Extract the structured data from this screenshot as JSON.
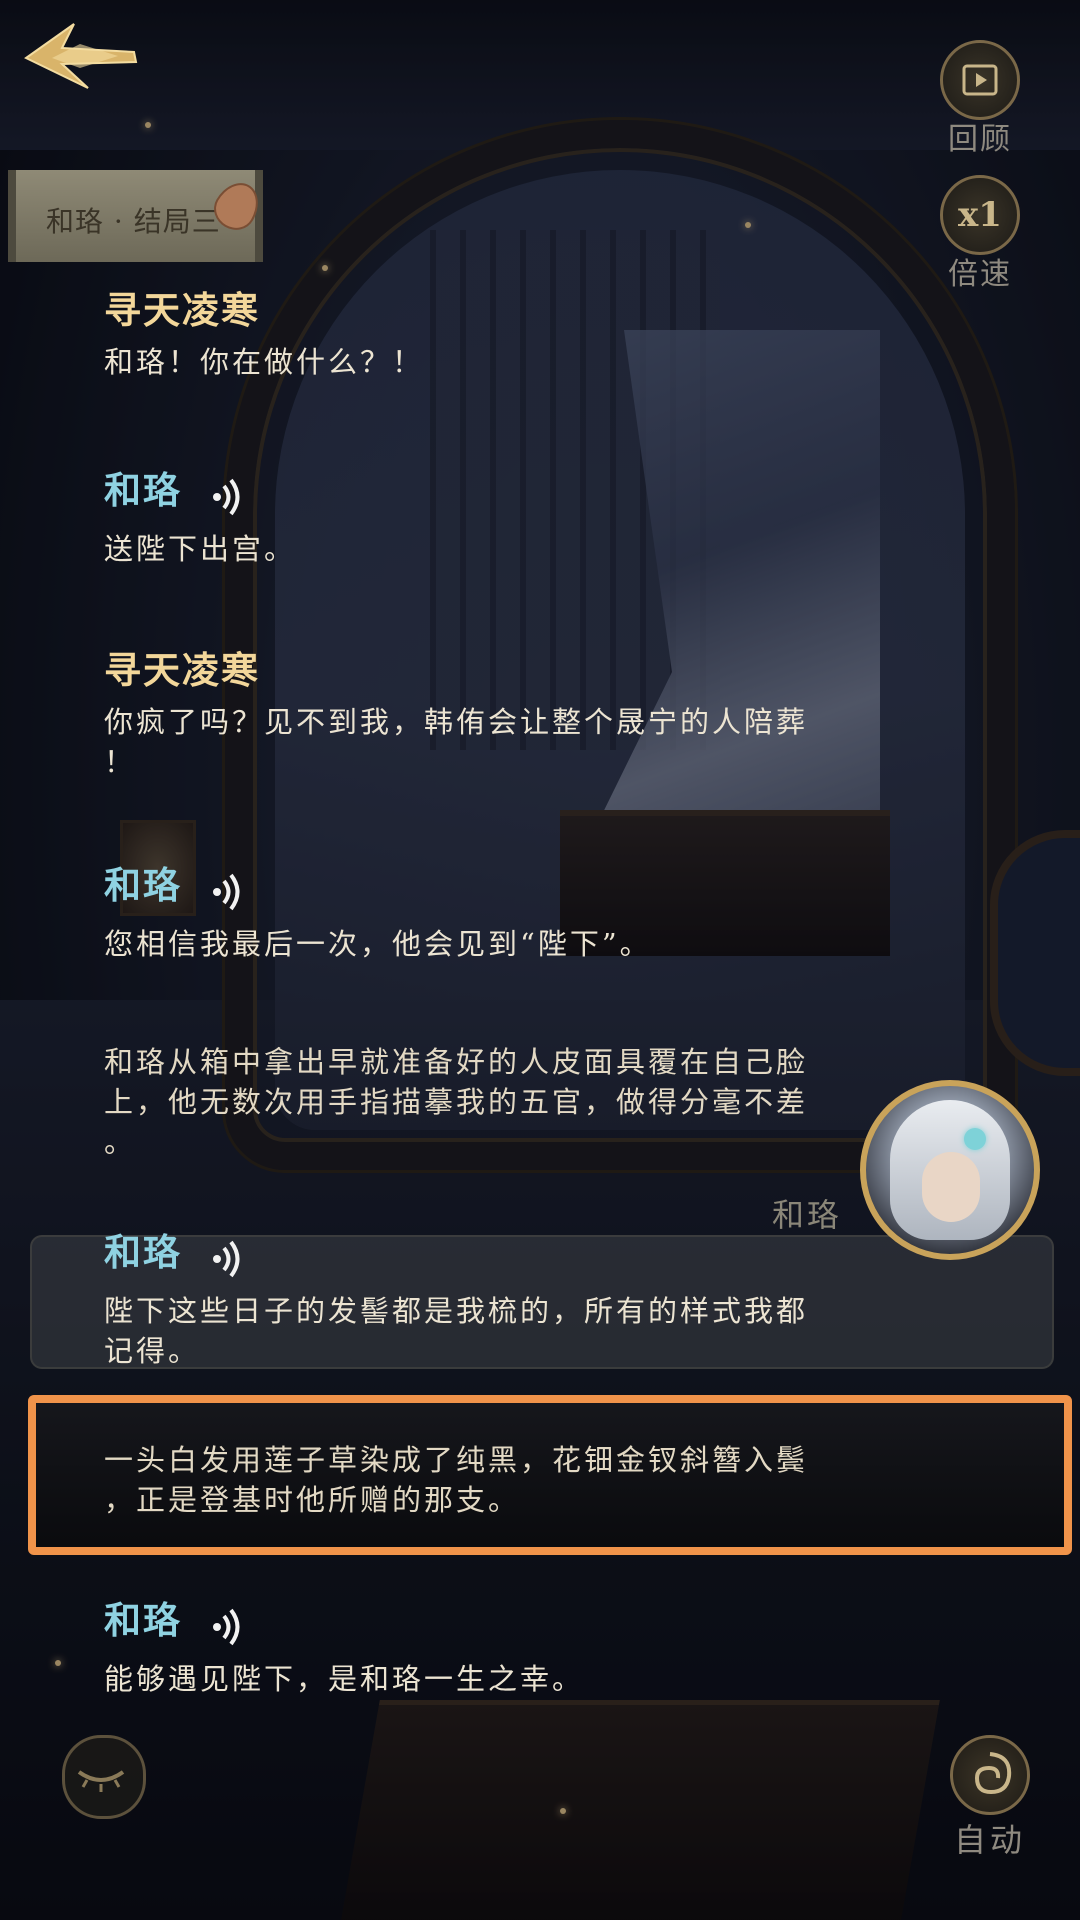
{
  "chapter_tag": "和珞 · 结局三",
  "side_buttons": {
    "review": {
      "label": "回顾"
    },
    "speed": {
      "value": "x1",
      "label": "倍速"
    }
  },
  "dialogue": [
    {
      "type": "speech",
      "speaker": "寻天凌寒",
      "speaker_style": "gold",
      "has_voice": false,
      "text": "和珞！你在做什么？！"
    },
    {
      "type": "speech",
      "speaker": "和珞",
      "speaker_style": "cyan",
      "has_voice": true,
      "text": "送陛下出宫。"
    },
    {
      "type": "speech",
      "speaker": "寻天凌寒",
      "speaker_style": "gold",
      "has_voice": false,
      "text_lines": [
        "你疯了吗？见不到我，韩侑会让整个晟宁的人陪葬",
        "！"
      ]
    },
    {
      "type": "speech",
      "speaker": "和珞",
      "speaker_style": "cyan",
      "has_voice": true,
      "text": "您相信我最后一次，他会见到“陛下”。"
    },
    {
      "type": "narration",
      "text_lines": [
        "和珞从箱中拿出早就准备好的人皮面具覆在自己脸",
        "上，他无数次用手指描摹我的五官，做得分毫不差",
        "。"
      ]
    },
    {
      "type": "speech",
      "speaker": "和珞",
      "speaker_style": "cyan",
      "has_voice": true,
      "text_lines": [
        "陛下这些日子的发髻都是我梳的，所有的样式我都",
        "记得。"
      ]
    },
    {
      "type": "narration",
      "highlighted": true,
      "text_lines": [
        "一头白发用莲子草染成了纯黑，花钿金钗斜簪入鬓",
        "，正是登基时他所赠的那支。"
      ]
    },
    {
      "type": "speech",
      "speaker": "和珞",
      "speaker_style": "cyan",
      "has_voice": true,
      "text": "能够遇见陛下，是和珞一生之幸。"
    }
  ],
  "portrait": {
    "name": "和珞"
  },
  "bottom": {
    "auto_label": "自动"
  },
  "colors": {
    "highlight": "#f0934a",
    "speaker_gold": "#f3d79a",
    "speaker_cyan": "#8fd2e2"
  }
}
